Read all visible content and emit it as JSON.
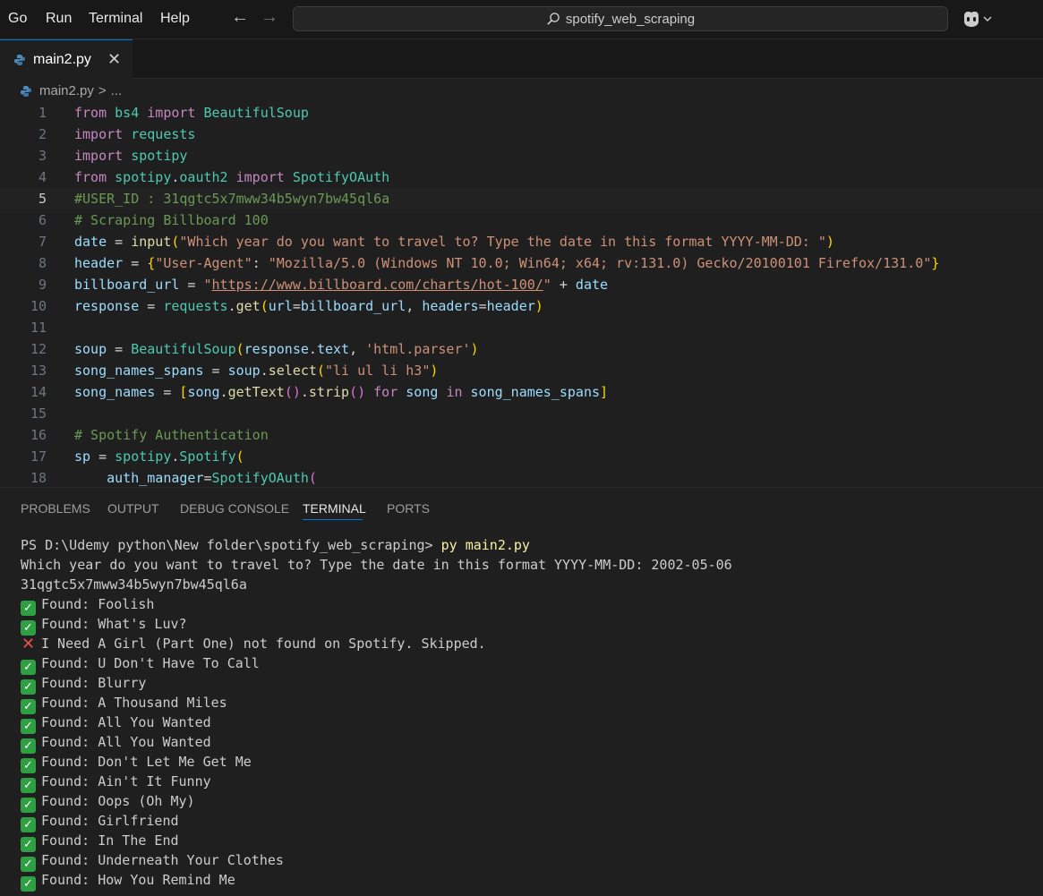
{
  "menu": [
    "Go",
    "Run",
    "Terminal",
    "Help"
  ],
  "search": {
    "text": "spotify_web_scraping"
  },
  "tab": {
    "filename": "main2.py"
  },
  "breadcrumb": {
    "file": "main2.py",
    "sep": ">",
    "rest": "..."
  },
  "code": {
    "active_line": 5,
    "line_numbers": [
      "1",
      "2",
      "3",
      "4",
      "5",
      "6",
      "7",
      "8",
      "9",
      "10",
      "11",
      "12",
      "13",
      "14",
      "15",
      "16",
      "17",
      "18"
    ],
    "l1": {
      "a": "from",
      "b": "bs4",
      "c": "import",
      "d": "BeautifulSoup"
    },
    "l2": {
      "a": "import",
      "b": "requests"
    },
    "l3": {
      "a": "import",
      "b": "spotipy"
    },
    "l4": {
      "a": "from",
      "b": "spotipy",
      "c": "oauth2",
      "d": "import",
      "e": "SpotifyOAuth"
    },
    "l5": {
      "comment": "#USER_ID : 31qgtc5x7mww34b5wyn7bw45ql6a"
    },
    "l6": {
      "comment": "# Scraping Billboard 100"
    },
    "l7": {
      "var": "date",
      "fn": "input",
      "str": "\"Which year do you want to travel to? Type the date in this format YYYY-MM-DD: \""
    },
    "l8": {
      "var": "header",
      "k1": "\"User-Agent\"",
      "v1": "\"Mozilla/5.0 (Windows NT 10.0; Win64; x64; rv:131.0) Gecko/20100101 Firefox/131.0\""
    },
    "l9": {
      "var": "billboard_url",
      "q1": "\"",
      "url": "https://www.billboard.com/charts/hot-100/",
      "q2": "\"",
      "var2": "date"
    },
    "l10": {
      "var": "response",
      "mod": "requests",
      "fn": "get",
      "arg1": "url",
      "val1": "billboard_url",
      "arg2": "headers",
      "val2": "header"
    },
    "l12": {
      "var": "soup",
      "cls": "BeautifulSoup",
      "obj": "response",
      "attr": "text",
      "str": "'html.parser'"
    },
    "l13": {
      "var": "song_names_spans",
      "obj": "soup",
      "fn": "select",
      "str": "\"li ul li h3\""
    },
    "l14": {
      "var": "song_names",
      "v2": "song",
      "fn1": "getText",
      "fn2": "strip",
      "kw1": "for",
      "v3": "song",
      "kw2": "in",
      "v4": "song_names_spans"
    },
    "l16": {
      "comment": "# Spotify Authentication"
    },
    "l17": {
      "var": "sp",
      "mod": "spotipy",
      "cls": "Spotify"
    },
    "l18": {
      "arg": "auth_manager",
      "cls": "SpotifyOAuth"
    }
  },
  "panel_tabs": [
    "PROBLEMS",
    "OUTPUT",
    "DEBUG CONSOLE",
    "TERMINAL",
    "PORTS"
  ],
  "terminal": {
    "prompt": "PS D:\\Udemy python\\New folder\\spotify_web_scraping> ",
    "command": "py main2.py",
    "line2": "Which year do you want to travel to? Type the date in this format YYYY-MM-DD: 2002-05-06",
    "line3": "31qgtc5x7mww34b5wyn7bw45ql6a",
    "results": [
      {
        "status": "found",
        "text": "Found: Foolish"
      },
      {
        "status": "found",
        "text": "Found: What's Luv?"
      },
      {
        "status": "skipped",
        "text": "I Need A Girl (Part One) not found on Spotify. Skipped."
      },
      {
        "status": "found",
        "text": "Found: U Don't Have To Call"
      },
      {
        "status": "found",
        "text": "Found: Blurry"
      },
      {
        "status": "found",
        "text": "Found: A Thousand Miles"
      },
      {
        "status": "found",
        "text": "Found: All You Wanted"
      },
      {
        "status": "found",
        "text": "Found: All You Wanted"
      },
      {
        "status": "found",
        "text": "Found: Don't Let Me Get Me"
      },
      {
        "status": "found",
        "text": "Found: Ain't It Funny"
      },
      {
        "status": "found",
        "text": "Found: Oops (Oh My)"
      },
      {
        "status": "found",
        "text": "Found: Girlfriend"
      },
      {
        "status": "found",
        "text": "Found: In The End"
      },
      {
        "status": "found",
        "text": "Found: Underneath Your Clothes"
      },
      {
        "status": "found",
        "text": "Found: How You Remind Me"
      }
    ]
  },
  "colors": {
    "accent": "#0078d4",
    "found_badge": "#2ea043",
    "skipped_mark": "#e5534b"
  }
}
